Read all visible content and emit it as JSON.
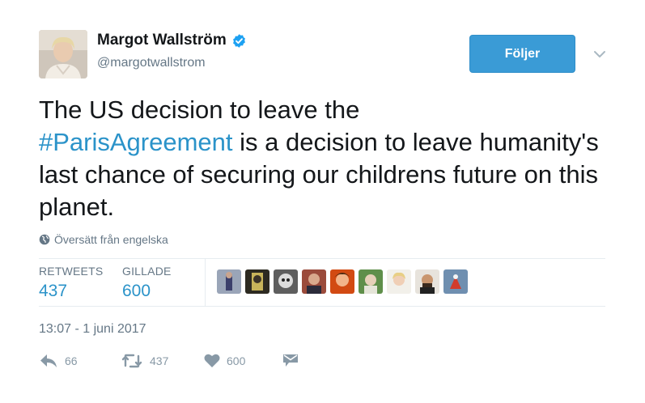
{
  "author": {
    "name": "Margot Wallström",
    "handle": "@margotwallstrom",
    "verified_icon": "verified-badge-icon"
  },
  "follow_button": {
    "label": "Följer"
  },
  "tweet": {
    "text_part1": "The US decision to leave the",
    "hashtag": "#ParisAgreement",
    "text_part2": " is a decision to leave humanity's last chance of securing our childrens future on this planet."
  },
  "translate": {
    "icon": "globe-icon",
    "label": "Översätt från engelska"
  },
  "stats": {
    "retweets_label": "RETWEETS",
    "retweets_value": "437",
    "likes_label": "GILLADE",
    "likes_value": "600"
  },
  "timestamp": "13:07 - 1 juni 2017",
  "actions": {
    "reply_count": "66",
    "retweet_count": "437",
    "like_count": "600"
  },
  "colors": {
    "accent": "#2b93c9",
    "follow_button": "#3a9bd6",
    "muted": "#657786",
    "icon": "#8899a6"
  }
}
